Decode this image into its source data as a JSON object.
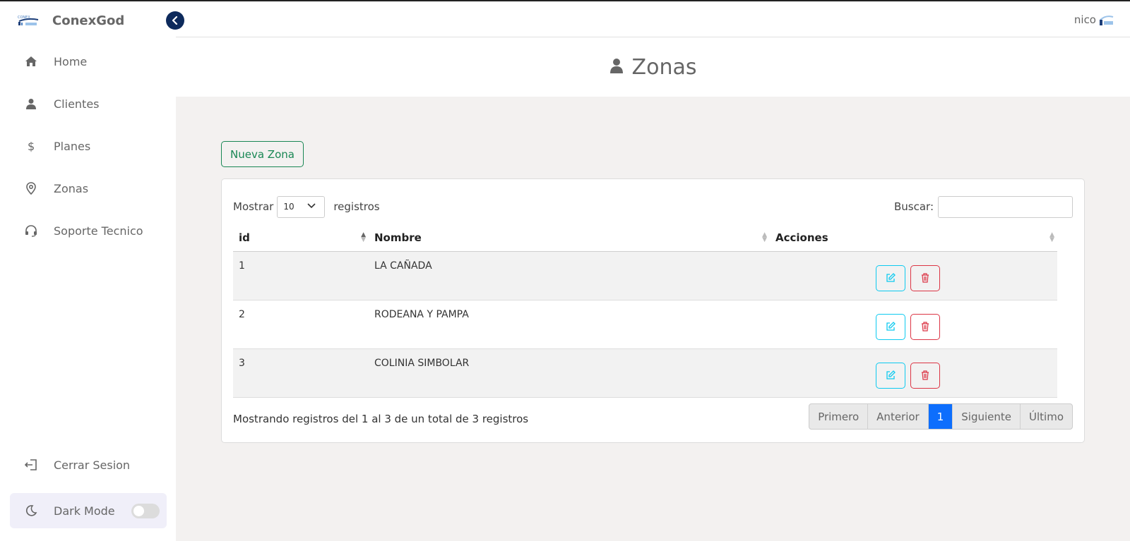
{
  "brand": {
    "name": "ConexGod",
    "logo_icon": "conexgod-logo"
  },
  "sidebar": {
    "items": [
      {
        "label": "Home",
        "icon": "home-icon"
      },
      {
        "label": "Clientes",
        "icon": "user-icon"
      },
      {
        "label": "Planes",
        "icon": "dollar-icon"
      },
      {
        "label": "Zonas",
        "icon": "map-pin-icon"
      },
      {
        "label": "Soporte Tecnico",
        "icon": "headset-icon"
      }
    ],
    "logout_label": "Cerrar Sesion",
    "dark_mode_label": "Dark Mode",
    "dark_mode_on": false
  },
  "topbar": {
    "user_name": "nico"
  },
  "page": {
    "title": "Zonas",
    "new_button": "Nueva Zona"
  },
  "table": {
    "length_label_before": "Mostrar",
    "length_value": "10",
    "length_label_after": "registros",
    "search_label": "Buscar:",
    "search_value": "",
    "columns": [
      "id",
      "Nombre",
      "Acciones"
    ],
    "rows": [
      {
        "id": "1",
        "nombre": "LA CAÑADA"
      },
      {
        "id": "2",
        "nombre": "RODEANA Y PAMPA"
      },
      {
        "id": "3",
        "nombre": "COLINIA SIMBOLAR"
      }
    ],
    "info": "Mostrando registros del 1 al 3 de un total de 3 registros",
    "pagination": {
      "first": "Primero",
      "prev": "Anterior",
      "current": "1",
      "next": "Siguiente",
      "last": "Último"
    }
  },
  "colors": {
    "accent": "#0d6efd",
    "success": "#198754",
    "info": "#0dcaf0",
    "danger": "#dc3545",
    "collapse": "#0d2a5c"
  }
}
